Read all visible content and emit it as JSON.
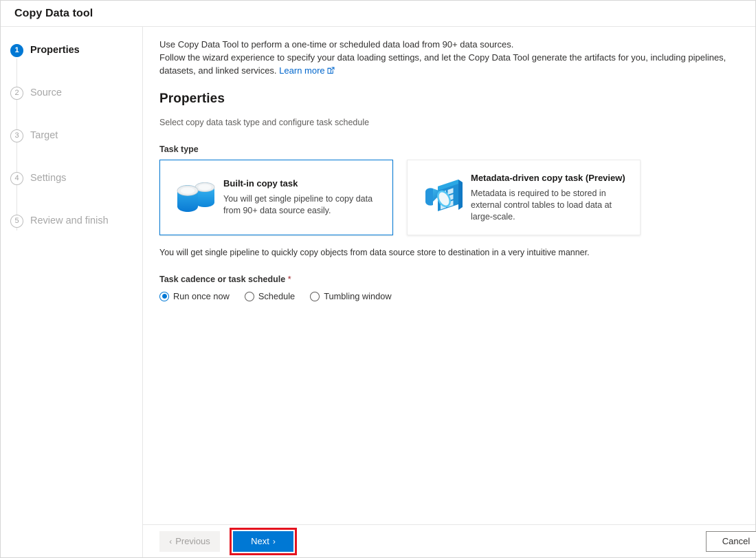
{
  "window": {
    "title": "Copy Data tool"
  },
  "sidebar": {
    "steps": [
      {
        "num": "1",
        "label": "Properties",
        "state": "active"
      },
      {
        "num": "2",
        "label": "Source",
        "state": "inactive"
      },
      {
        "num": "3",
        "label": "Target",
        "state": "inactive"
      },
      {
        "num": "4",
        "label": "Settings",
        "state": "inactive"
      },
      {
        "num": "5",
        "label": "Review and finish",
        "state": "inactive"
      }
    ]
  },
  "main": {
    "intro_line1": "Use Copy Data Tool to perform a one-time or scheduled data load from 90+ data sources.",
    "intro_line2": "Follow the wizard experience to specify your data loading settings, and let the Copy Data Tool generate the artifacts for you, including pipelines, datasets, and linked services.",
    "learn_more": "Learn more",
    "section_title": "Properties",
    "section_subtitle": "Select copy data task type and configure task schedule",
    "task_type_label": "Task type",
    "cards": [
      {
        "title": "Built-in copy task",
        "desc": "You will get single pipeline to copy data from 90+ data source easily.",
        "icon": "database-copy-icon",
        "selected": true
      },
      {
        "title": "Metadata-driven copy task (Preview)",
        "desc": "Metadata is required to be stored in external control tables to load data at large-scale.",
        "icon": "metadata-table-search-icon",
        "selected": false
      }
    ],
    "note": "You will get single pipeline to quickly copy objects from data source store to destination in a very intuitive manner.",
    "cadence_label": "Task cadence or task schedule",
    "cadence_required_mark": "*",
    "cadence_options": [
      {
        "label": "Run once now",
        "selected": true
      },
      {
        "label": "Schedule",
        "selected": false
      },
      {
        "label": "Tumbling window",
        "selected": false
      }
    ]
  },
  "footer": {
    "previous_label": "Previous",
    "next_label": "Next",
    "cancel_label": "Cancel",
    "previous_chevron": "‹",
    "next_chevron": "›"
  },
  "colors": {
    "accent": "#0078d4",
    "highlight_box": "#e5131f",
    "link": "#0066cc",
    "required": "#a4262c"
  }
}
